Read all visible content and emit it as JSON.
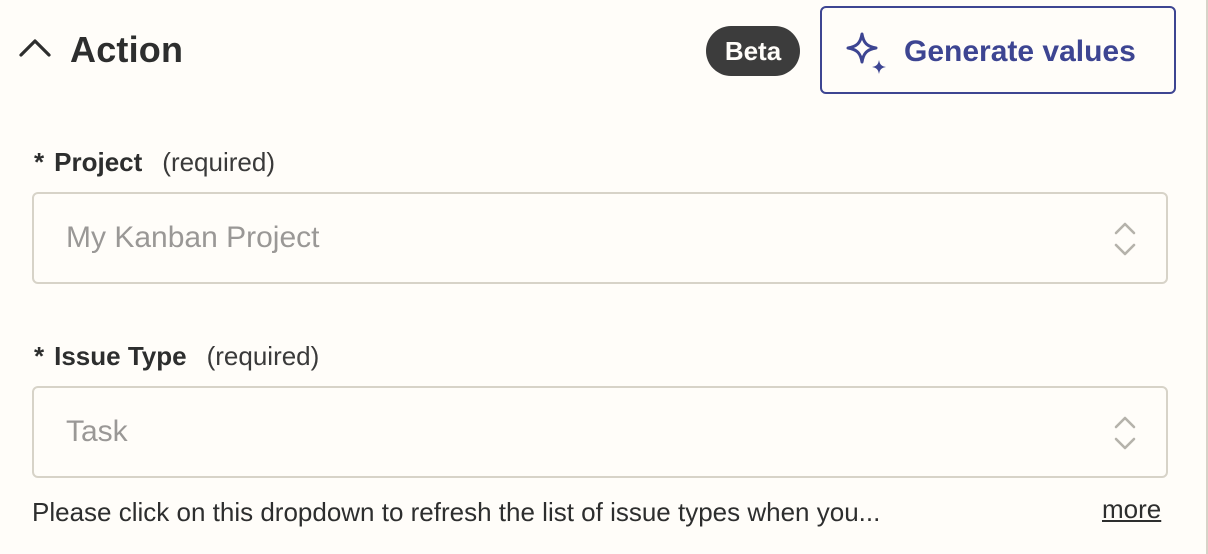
{
  "header": {
    "title": "Action",
    "badge": "Beta",
    "generate_button_label": "Generate values"
  },
  "fields": [
    {
      "asterisk": "*",
      "label": "Project",
      "required_text": "(required)",
      "value": "My Kanban Project"
    },
    {
      "asterisk": "*",
      "label": "Issue Type",
      "required_text": "(required)",
      "value": "Task",
      "helper_text": "Please click on this dropdown to refresh the list of issue types when you...",
      "more_label": "more"
    }
  ],
  "icons": {
    "collapse": "chevron-up-icon",
    "generate": "sparkle-icon",
    "select": "updown-chevron-icon"
  },
  "colors": {
    "background": "#fffdf9",
    "accent": "#3d4592",
    "badge_bg": "#3c3c3c",
    "border": "#d7d3c8",
    "placeholder_text": "#9a9896"
  }
}
